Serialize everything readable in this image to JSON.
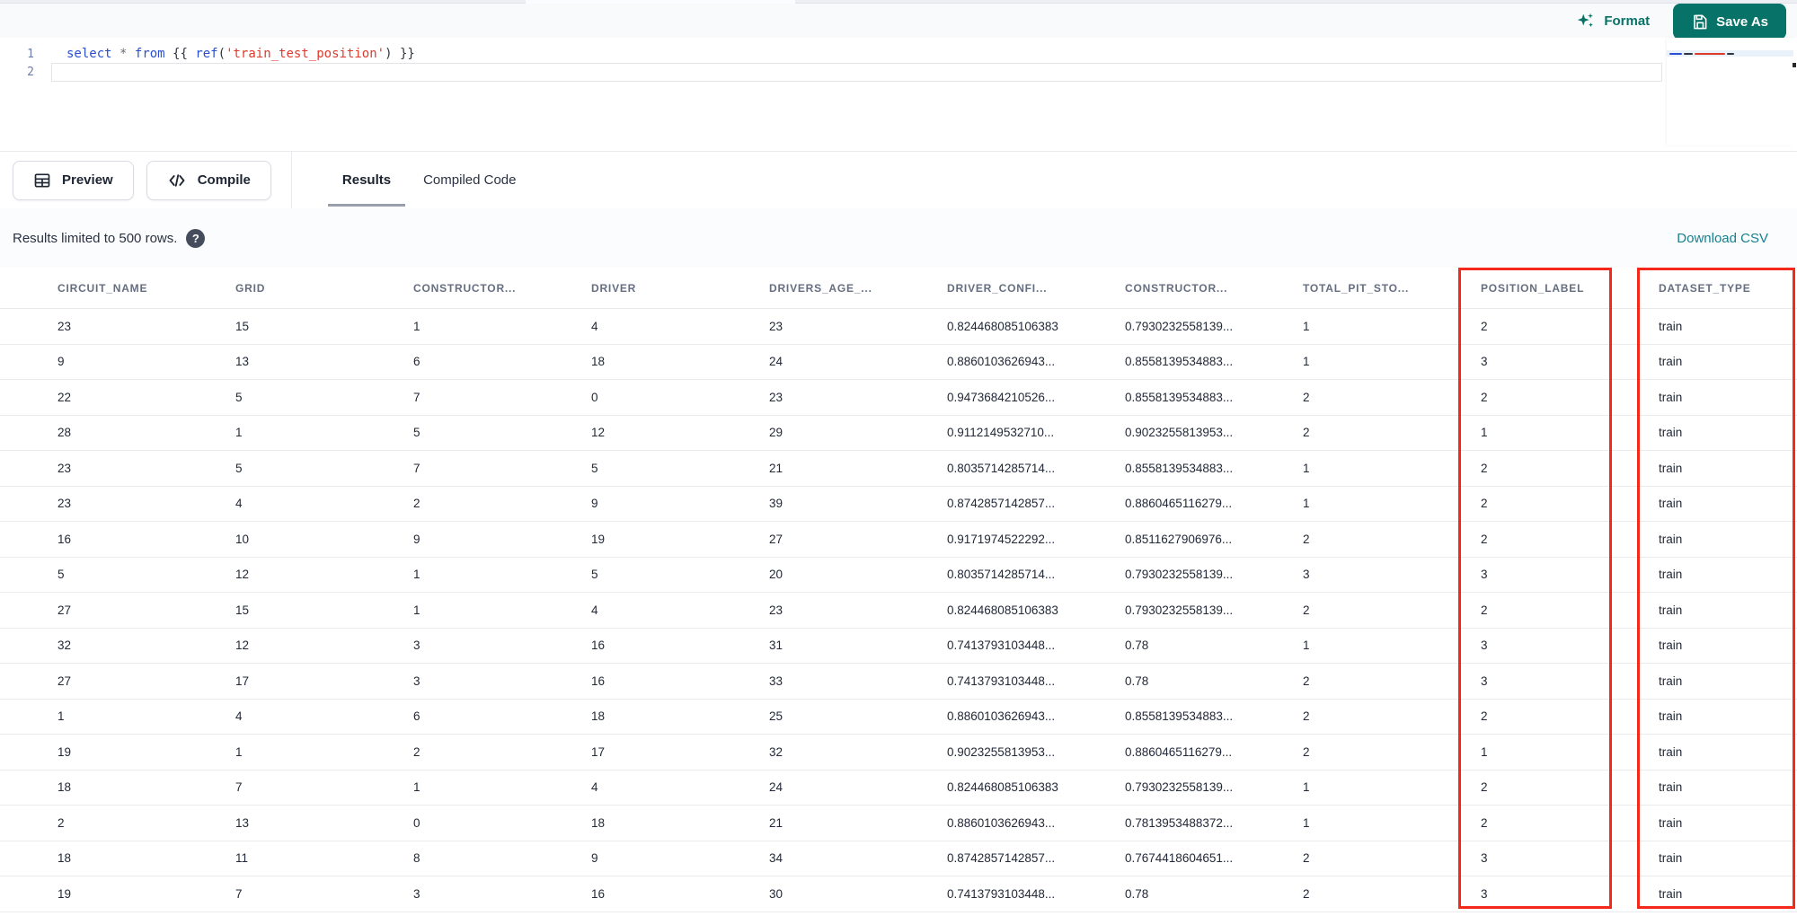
{
  "toolbar": {
    "format_label": "Format",
    "save_as_label": "Save As"
  },
  "editor": {
    "lines": [
      {
        "number": "1"
      },
      {
        "number": "2"
      }
    ],
    "tokens": [
      {
        "text": "select",
        "type": "keyword"
      },
      {
        "text": " ",
        "type": "plain"
      },
      {
        "text": "*",
        "type": "operator"
      },
      {
        "text": " ",
        "type": "plain"
      },
      {
        "text": "from",
        "type": "keyword"
      },
      {
        "text": " {{ ",
        "type": "plain"
      },
      {
        "text": "ref",
        "type": "function"
      },
      {
        "text": "(",
        "type": "plain"
      },
      {
        "text": "'train_test_position'",
        "type": "string"
      },
      {
        "text": ")",
        "type": "plain"
      },
      {
        "text": " }}",
        "type": "plain"
      }
    ]
  },
  "actions": {
    "preview_label": "Preview",
    "compile_label": "Compile"
  },
  "tabs": [
    {
      "label": "Results",
      "active": true
    },
    {
      "label": "Compiled Code",
      "active": false
    }
  ],
  "results_bar": {
    "text": "Results limited to 500 rows.",
    "help_glyph": "?",
    "download_label": "Download CSV"
  },
  "table": {
    "columns": [
      "CIRCUIT_NAME",
      "GRID",
      "CONSTRUCTOR...",
      "DRIVER",
      "DRIVERS_AGE_...",
      "DRIVER_CONFI...",
      "CONSTRUCTOR...",
      "TOTAL_PIT_STO...",
      "POSITION_LABEL",
      "DATASET_TYPE"
    ],
    "highlighted_columns": [
      "POSITION_LABEL",
      "DATASET_TYPE"
    ],
    "rows": [
      [
        "23",
        "15",
        "1",
        "4",
        "23",
        "0.824468085106383",
        "0.7930232558139...",
        "1",
        "2",
        "train"
      ],
      [
        "9",
        "13",
        "6",
        "18",
        "24",
        "0.8860103626943...",
        "0.8558139534883...",
        "1",
        "3",
        "train"
      ],
      [
        "22",
        "5",
        "7",
        "0",
        "23",
        "0.9473684210526...",
        "0.8558139534883...",
        "2",
        "2",
        "train"
      ],
      [
        "28",
        "1",
        "5",
        "12",
        "29",
        "0.9112149532710...",
        "0.9023255813953...",
        "2",
        "1",
        "train"
      ],
      [
        "23",
        "5",
        "7",
        "5",
        "21",
        "0.8035714285714...",
        "0.8558139534883...",
        "1",
        "2",
        "train"
      ],
      [
        "23",
        "4",
        "2",
        "9",
        "39",
        "0.8742857142857...",
        "0.8860465116279...",
        "1",
        "2",
        "train"
      ],
      [
        "16",
        "10",
        "9",
        "19",
        "27",
        "0.9171974522292...",
        "0.8511627906976...",
        "2",
        "2",
        "train"
      ],
      [
        "5",
        "12",
        "1",
        "5",
        "20",
        "0.8035714285714...",
        "0.7930232558139...",
        "3",
        "3",
        "train"
      ],
      [
        "27",
        "15",
        "1",
        "4",
        "23",
        "0.824468085106383",
        "0.7930232558139...",
        "2",
        "2",
        "train"
      ],
      [
        "32",
        "12",
        "3",
        "16",
        "31",
        "0.7413793103448...",
        "0.78",
        "1",
        "3",
        "train"
      ],
      [
        "27",
        "17",
        "3",
        "16",
        "33",
        "0.7413793103448...",
        "0.78",
        "2",
        "3",
        "train"
      ],
      [
        "1",
        "4",
        "6",
        "18",
        "25",
        "0.8860103626943...",
        "0.8558139534883...",
        "2",
        "2",
        "train"
      ],
      [
        "19",
        "1",
        "2",
        "17",
        "32",
        "0.9023255813953...",
        "0.8860465116279...",
        "2",
        "1",
        "train"
      ],
      [
        "18",
        "7",
        "1",
        "4",
        "24",
        "0.824468085106383",
        "0.7930232558139...",
        "1",
        "2",
        "train"
      ],
      [
        "2",
        "13",
        "0",
        "18",
        "21",
        "0.8860103626943...",
        "0.7813953488372...",
        "1",
        "2",
        "train"
      ],
      [
        "18",
        "11",
        "8",
        "9",
        "34",
        "0.8742857142857...",
        "0.7674418604651...",
        "2",
        "3",
        "train"
      ],
      [
        "19",
        "7",
        "3",
        "16",
        "30",
        "0.7413793103448...",
        "0.78",
        "2",
        "3",
        "train"
      ]
    ]
  },
  "colors": {
    "accent_teal": "#077268",
    "link_teal": "#177f8e",
    "highlight_red": "#f5281c",
    "keyword_blue": "#2b4fce",
    "string_red": "#df3a2b"
  }
}
